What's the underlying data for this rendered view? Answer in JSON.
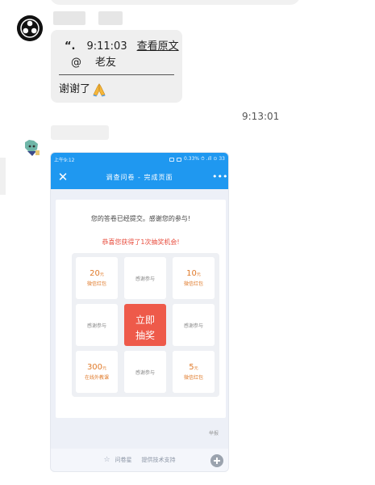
{
  "chat": {
    "message1": {
      "quote_mark": "“.",
      "quote_time": "9:11:03",
      "view_original": "查看原文",
      "at_symbol": "@",
      "nickname": "老友",
      "reply_text": "谢谢了",
      "emoji": "folded-hands"
    },
    "timestamp": "9:13:01"
  },
  "phone": {
    "status_left": "上午9:12",
    "status_right": "0.33%  ⏱ .ıll ⊙ 33",
    "title": "调查问卷 - 完成页面",
    "close_glyph": "✕",
    "more_glyph": "•••",
    "submitted_msg": "您的答卷已经提交。感谢您的参与!",
    "congrats_msg": "恭喜您获得了1次抽奖机会!",
    "prizes": {
      "p1_amount": "20",
      "p1_unit": "元",
      "p1_label": "微信红包",
      "p2_label": "感谢参与",
      "p3_amount": "10",
      "p3_unit": "元",
      "p3_label": "微信红包",
      "p4_label": "感谢参与",
      "draw_line1": "立即",
      "draw_line2": "抽奖",
      "p6_label": "感谢参与",
      "p7_amount": "300",
      "p7_unit": "元",
      "p7_label": "在线外教课",
      "p8_label": "感谢参与",
      "p9_amount": "5",
      "p9_unit": "元",
      "p9_label": "微信红包"
    },
    "report": "举报",
    "footer_brand": "问卷星",
    "footer_text": "提供技术支持"
  },
  "colors": {
    "header_blue": "#1f98f0",
    "draw_red": "#ee5a4a",
    "prize_orange": "#e07a2a",
    "congrats_red": "#e84c3d"
  }
}
